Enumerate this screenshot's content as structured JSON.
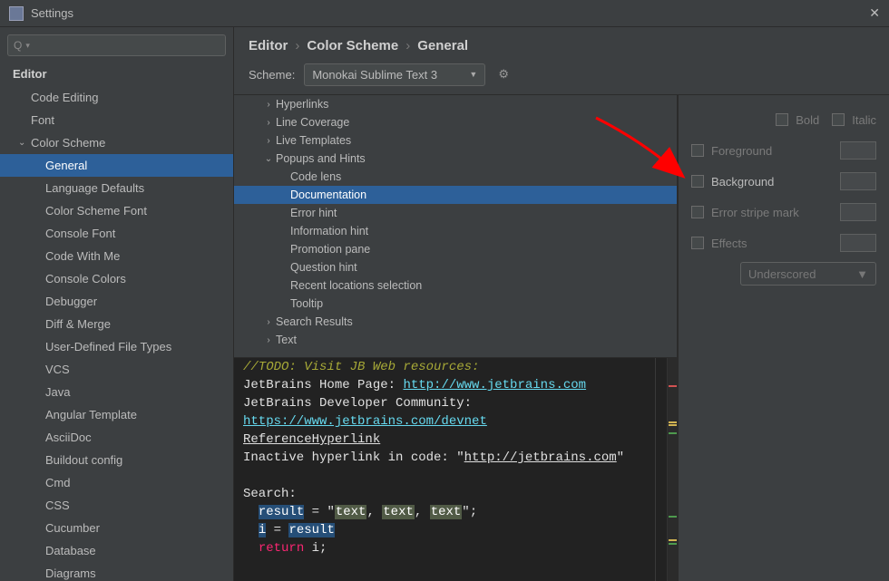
{
  "window": {
    "title": "Settings"
  },
  "breadcrumb": {
    "a": "Editor",
    "b": "Color Scheme",
    "c": "General"
  },
  "scheme": {
    "label": "Scheme:",
    "value": "Monokai Sublime Text 3"
  },
  "sidebar": {
    "root": "Editor",
    "expanded": "Color Scheme",
    "selected": "General",
    "items_top": [
      "Code Editing",
      "Font"
    ],
    "child_items": [
      "General",
      "Language Defaults",
      "Color Scheme Font",
      "Console Font",
      "Code With Me",
      "Console Colors",
      "Debugger",
      "Diff & Merge",
      "User-Defined File Types",
      "VCS",
      "Java",
      "Angular Template",
      "AsciiDoc",
      "Buildout config",
      "Cmd",
      "CSS",
      "Cucumber",
      "Database",
      "Diagrams"
    ]
  },
  "cats": {
    "items": [
      {
        "label": "Hyperlinks",
        "depth": 0,
        "arrow": ">"
      },
      {
        "label": "Line Coverage",
        "depth": 0,
        "arrow": ">"
      },
      {
        "label": "Live Templates",
        "depth": 0,
        "arrow": ">"
      },
      {
        "label": "Popups and Hints",
        "depth": 0,
        "arrow": "v"
      },
      {
        "label": "Code lens",
        "depth": 1,
        "arrow": ""
      },
      {
        "label": "Documentation",
        "depth": 1,
        "arrow": "",
        "selected": true
      },
      {
        "label": "Error hint",
        "depth": 1,
        "arrow": ""
      },
      {
        "label": "Information hint",
        "depth": 1,
        "arrow": ""
      },
      {
        "label": "Promotion pane",
        "depth": 1,
        "arrow": ""
      },
      {
        "label": "Question hint",
        "depth": 1,
        "arrow": ""
      },
      {
        "label": "Recent locations selection",
        "depth": 1,
        "arrow": ""
      },
      {
        "label": "Tooltip",
        "depth": 1,
        "arrow": ""
      },
      {
        "label": "Search Results",
        "depth": 0,
        "arrow": ">"
      },
      {
        "label": "Text",
        "depth": 0,
        "arrow": ">"
      }
    ]
  },
  "opts": {
    "bold": "Bold",
    "italic": "Italic",
    "foreground": "Foreground",
    "background": "Background",
    "errstripe": "Error stripe mark",
    "effects": "Effects",
    "effectsType": "Underscored"
  },
  "preview": {
    "todo": "//TODO: Visit JB Web resources:",
    "l1a": "JetBrains Home Page: ",
    "l1b": "http://www.jetbrains.com",
    "l2a": "JetBrains Developer Community: ",
    "l2b": "https://www.jetbrains.com/devnet",
    "l3": "ReferenceHyperlink",
    "l4a": "Inactive hyperlink in code: \"",
    "l4b": "http://jetbrains.com",
    "l4c": "\"",
    "l5": "Search:",
    "l6a": "result",
    "l6b": " = \"",
    "l6c": "text",
    "l6d": ", ",
    "l6e": "text",
    "l6f": ", ",
    "l6g": "text",
    "l6h": "\";",
    "l7a": "i",
    "l7b": " = ",
    "l7c": "result",
    "l8a": "return ",
    "l8b": "i;"
  }
}
